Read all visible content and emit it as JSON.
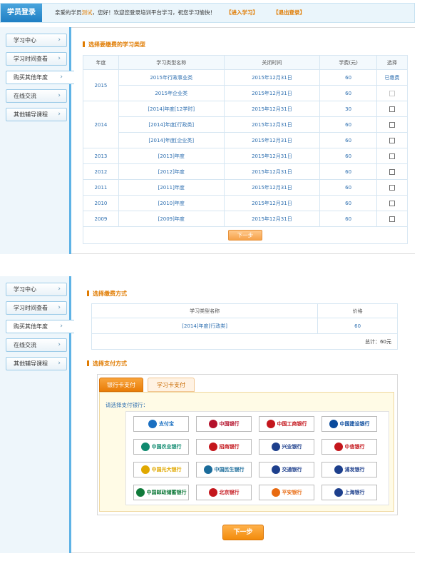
{
  "topbar": {
    "logo": "学员登录",
    "welcome_prefix": "亲爱的学员",
    "user_name": "测试",
    "welcome_suffix": "，您好！欢迎您登录培训平台学习，祝您学习愉快！",
    "enter_study": "【进入学习】",
    "logout": "【退出登录】"
  },
  "sidebar": {
    "items": [
      {
        "label": "学习中心"
      },
      {
        "label": "学习时间查看"
      },
      {
        "label": "购买其他年度"
      },
      {
        "label": "在线交流"
      },
      {
        "label": "其他辅导课程"
      }
    ],
    "active_index": 2
  },
  "section1": {
    "title": "选择要缴费的学习类型",
    "headers": [
      "年度",
      "学习类型名称",
      "关闭时间",
      "学费(元)",
      "选择"
    ],
    "groups": [
      {
        "year": "2015",
        "rows": [
          {
            "name": "2015年行政事业类",
            "close": "2015年12月31日",
            "fee": "60",
            "choice": "已缴费"
          },
          {
            "name": "2015年企业类",
            "close": "2015年12月31日",
            "fee": "60",
            "choice": "disabled"
          }
        ]
      },
      {
        "year": "2014",
        "rows": [
          {
            "name": "[2014]年度[12学时]",
            "close": "2015年12月31日",
            "fee": "30",
            "choice": "checkbox"
          },
          {
            "name": "[2014]年度[行政类]",
            "close": "2015年12月31日",
            "fee": "60",
            "choice": "checkbox"
          },
          {
            "name": "[2014]年度[企业类]",
            "close": "2015年12月31日",
            "fee": "60",
            "choice": "checkbox"
          }
        ]
      },
      {
        "year": "2013",
        "rows": [
          {
            "name": "[2013]年度",
            "close": "2015年12月31日",
            "fee": "60",
            "choice": "checkbox"
          }
        ]
      },
      {
        "year": "2012",
        "rows": [
          {
            "name": "[2012]年度",
            "close": "2015年12月31日",
            "fee": "60",
            "choice": "checkbox"
          }
        ]
      },
      {
        "year": "2011",
        "rows": [
          {
            "name": "[2011]年度",
            "close": "2015年12月31日",
            "fee": "60",
            "choice": "checkbox"
          }
        ]
      },
      {
        "year": "2010",
        "rows": [
          {
            "name": "[2010]年度",
            "close": "2015年12月31日",
            "fee": "60",
            "choice": "checkbox"
          }
        ]
      },
      {
        "year": "2009",
        "rows": [
          {
            "name": "[2009]年度",
            "close": "2015年12月31日",
            "fee": "60",
            "choice": "checkbox"
          }
        ]
      }
    ],
    "next_label": "下一步"
  },
  "section2": {
    "title": "选择缴费方式",
    "headers": [
      "学习类型名称",
      "价格"
    ],
    "row": {
      "name": "[2014]年度[行政类]",
      "price": "60"
    },
    "total": "总计：60元"
  },
  "section3": {
    "title": "选择支付方式",
    "tabs": [
      "银行卡支付",
      "学习卡支付"
    ],
    "prompt": "请选择支付银行：",
    "banks": [
      {
        "name": "支付宝",
        "color": "#1a6fc1"
      },
      {
        "name": "中国银行",
        "color": "#b4112b"
      },
      {
        "name": "中国工商银行",
        "color": "#c4161c"
      },
      {
        "name": "中国建设银行",
        "color": "#0a4a9c"
      },
      {
        "name": "中国农业银行",
        "color": "#0f8a6f"
      },
      {
        "name": "招商银行",
        "color": "#c4161c"
      },
      {
        "name": "兴业银行",
        "color": "#1d3f8c"
      },
      {
        "name": "中信银行",
        "color": "#c4161c"
      },
      {
        "name": "中国光大银行",
        "color": "#e0a800"
      },
      {
        "name": "中国民生银行",
        "color": "#1a6b9a"
      },
      {
        "name": "交通银行",
        "color": "#1d3f8c"
      },
      {
        "name": "浦发银行",
        "color": "#1d3f8c"
      },
      {
        "name": "中国邮政储蓄银行",
        "color": "#0f7a3a"
      },
      {
        "name": "北京银行",
        "color": "#c4161c"
      },
      {
        "name": "平安银行",
        "color": "#e86a10"
      },
      {
        "name": "上海银行",
        "color": "#1d3f8c"
      }
    ],
    "next_label": "下一步"
  }
}
